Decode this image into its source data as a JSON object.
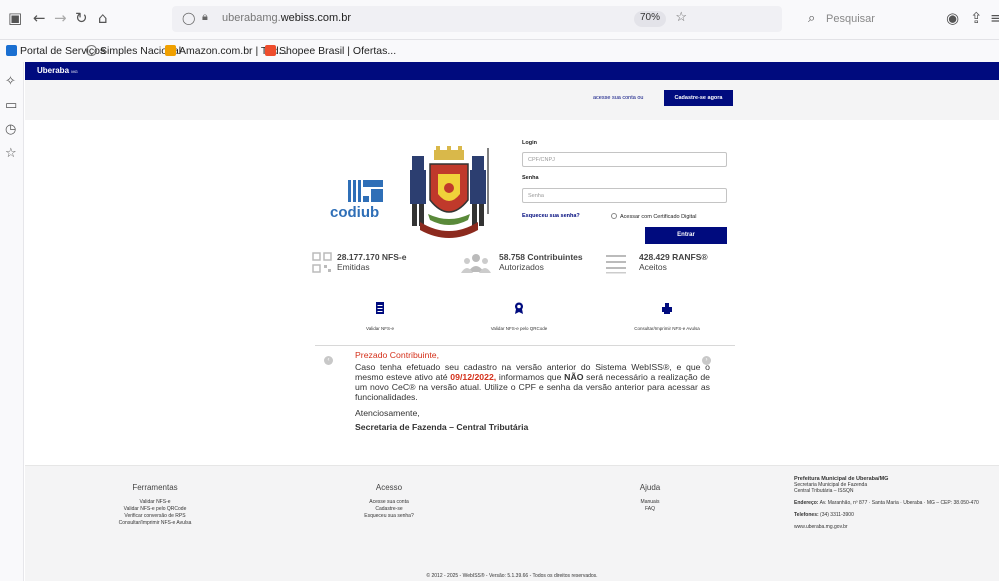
{
  "browser": {
    "url_prefix": "uberabamg.",
    "url_domain": "webiss.com.br",
    "zoom": "70%",
    "search_placeholder": "Pesquisar"
  },
  "bookmarks": [
    {
      "label": "Portal de Serviços",
      "color": "#1a6fd1"
    },
    {
      "label": "Simples Nacional",
      "color": "#777777"
    },
    {
      "label": "Amazon.com.br | Tud...",
      "color": "#f0a000"
    },
    {
      "label": "Shopee Brasil | Ofertas...",
      "color": "#ee4d2d"
    }
  ],
  "header": {
    "brand": "Uberaba",
    "brand_suffix": "MG"
  },
  "hero": {
    "login_link": "acesse sua conta ou",
    "register_button": "Cadastre-se agora"
  },
  "logo": {
    "text": "codiub"
  },
  "login": {
    "login_label": "Login",
    "login_placeholder": "CPF/CNPJ",
    "password_label": "Senha",
    "password_placeholder": "Senha",
    "forgot": "Esqueceu sua senha?",
    "certificate": "Acessar com Certificado Digital",
    "submit": "Entrar"
  },
  "stats": [
    {
      "value": "28.177.170 NFS-e",
      "caption": "Emitidas"
    },
    {
      "value": "58.758 Contribuintes",
      "caption": "Autorizados"
    },
    {
      "value": "428.429 RANFS®",
      "caption": "Aceitos"
    }
  ],
  "actions": [
    {
      "label": "Validar NFS-e"
    },
    {
      "label": "Validar NFS-e pelo QRCode"
    },
    {
      "label": "Consultar/Imprimir NFS-e Avulsa"
    }
  ],
  "notice": {
    "greeting": "Prezado Contribuinte,",
    "body_1": "Caso tenha efetuado seu cadastro na versão anterior do Sistema WebISS®, e que o mesmo esteve ativo até ",
    "date": "09/12/2022,",
    "body_2": " informamos que ",
    "nao": "NÃO",
    "body_3": " será necessário a realização de um novo CeC® na versão atual. Utilize o CPF e senha da versão anterior para acessar as funcionalidades.",
    "closing": "Atenciosamente,",
    "signature": "Secretaria de Fazenda – Central Tributária"
  },
  "footer": {
    "tools": {
      "title": "Ferramentas",
      "links": [
        "Validar NFS-e",
        "Validar NFS-e pelo QRCode",
        "Verificar conversão de RPS",
        "Consultar/Imprimir NFS-e Avulsa"
      ]
    },
    "access": {
      "title": "Acesso",
      "links": [
        "Acesse sua conta",
        "Cadastre-se",
        "Esqueceu sua senha?"
      ]
    },
    "help": {
      "title": "Ajuda",
      "links": [
        "Manuais",
        "FAQ"
      ]
    },
    "org": {
      "name": "Prefeitura Municipal de Uberaba/MG",
      "dept": "Secretaria Municipal de Fazenda",
      "unit": "Central Tributária – ISSQN",
      "address_label": "Endereço:",
      "address": "Av. Maranhão, nº 877 · Santa Maria · Uberaba · MG – CEP: 38.050-470",
      "phone_label": "Telefones:",
      "phone": "(34) 3311-3900",
      "site": "www.uberaba.mg.gov.br"
    },
    "copyright": "© 2012 - 2025 - WebISS® - Versão: 5.1.39.66 - Todos os direitos reservados."
  }
}
